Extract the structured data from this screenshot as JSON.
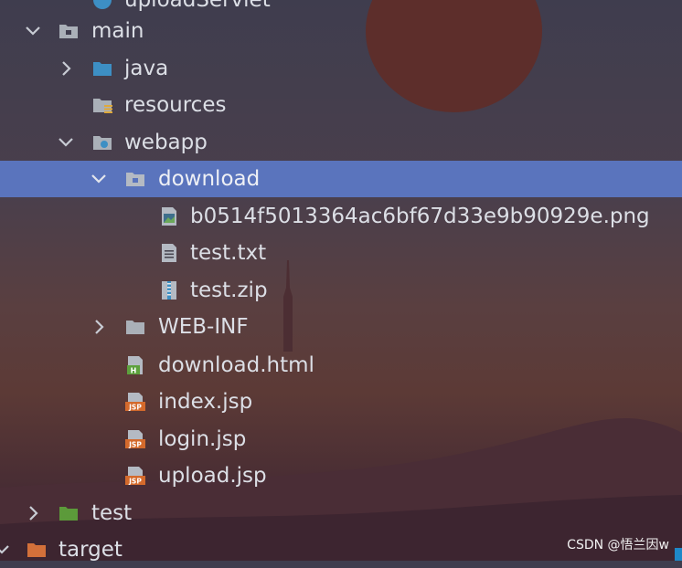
{
  "tree": {
    "items": [
      {
        "label": "uploadServlet",
        "icon": "class-icon"
      },
      {
        "label": "main",
        "icon": "folder-module-icon",
        "expanded": true
      },
      {
        "label": "java",
        "icon": "folder-source-icon",
        "expanded": false
      },
      {
        "label": "resources",
        "icon": "folder-resources-icon"
      },
      {
        "label": "webapp",
        "icon": "folder-web-icon",
        "expanded": true
      },
      {
        "label": "download",
        "icon": "folder-icon",
        "expanded": true,
        "selected": true
      },
      {
        "label": "b0514f5013364ac6bf67d33e9b90929e.png",
        "icon": "image-file-icon"
      },
      {
        "label": "test.txt",
        "icon": "text-file-icon"
      },
      {
        "label": "test.zip",
        "icon": "archive-file-icon"
      },
      {
        "label": "WEB-INF",
        "icon": "folder-icon",
        "expanded": false
      },
      {
        "label": "download.html",
        "icon": "html-file-icon"
      },
      {
        "label": "index.jsp",
        "icon": "jsp-file-icon"
      },
      {
        "label": "login.jsp",
        "icon": "jsp-file-icon"
      },
      {
        "label": "upload.jsp",
        "icon": "jsp-file-icon"
      },
      {
        "label": "test",
        "icon": "folder-test-icon",
        "expanded": false
      },
      {
        "label": "target",
        "icon": "folder-excluded-icon",
        "expanded": false
      }
    ]
  },
  "watermark": "CSDN @悟兰因w",
  "colors": {
    "selection": "#5a74bd",
    "folder": "#aab0b8",
    "source_folder": "#3d8fc4",
    "test_folder": "#5c9a3a",
    "target_folder": "#d3703a",
    "jsp_badge": "#d46a2c",
    "html_badge": "#5da13d"
  }
}
